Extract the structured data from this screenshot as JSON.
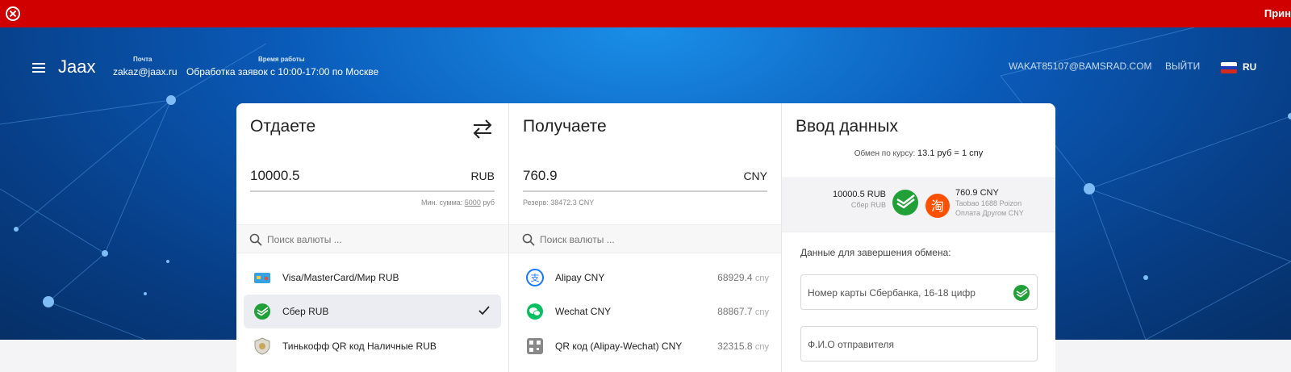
{
  "alert": {
    "text": "Прин"
  },
  "header": {
    "brand": "Jaax",
    "email_label": "Почта",
    "email_value": "zakaz@jaax.ru",
    "hours_label": "Время работы",
    "hours_value": "Обработка заявок с 10:00-17:00 по Москве",
    "user_email": "WAKAT85107@BAMSRAD.COM",
    "logout": "ВЫЙТИ",
    "lang": "RU"
  },
  "give": {
    "title": "Отдаете",
    "amount": "10000.5",
    "currency": "RUB",
    "min_prefix": "Мин. сумма: ",
    "min_value": "5000",
    "min_suffix": " руб",
    "search_placeholder": "Поиск валюты ...",
    "items": [
      {
        "label": "Visa/MasterCard/Мир RUB",
        "icon": "card-icon"
      },
      {
        "label": "Сбер RUB",
        "icon": "sber-icon",
        "selected": true
      },
      {
        "label": "Тинькофф QR код Наличные RUB",
        "icon": "tinkoff-icon"
      }
    ]
  },
  "get": {
    "title": "Получаете",
    "amount": "760.9",
    "currency": "CNY",
    "reserve": "Резерв: 38472.3 CNY",
    "search_placeholder": "Поиск валюты ...",
    "items": [
      {
        "label": "Alipay CNY",
        "value": "68929.4",
        "unit": "cny",
        "icon": "alipay-icon"
      },
      {
        "label": "Wechat CNY",
        "value": "88867.7",
        "unit": "cny",
        "icon": "wechat-icon"
      },
      {
        "label": "QR код (Alipay-Wechat) CNY",
        "value": "32315.8",
        "unit": "cny",
        "icon": "qr-icon"
      }
    ]
  },
  "details": {
    "title": "Ввод данных",
    "rate_label": "Обмен по курсу:",
    "rate_value": "13.1 руб = 1 cny",
    "give_amount": "10000.5 RUB",
    "give_name": "Сбер RUB",
    "get_amount": "760.9 CNY",
    "get_name1": "Taobao 1688 Poizon",
    "get_name2": "Оплата Другом CNY",
    "finish_label": "Данные для завершения обмена:",
    "card_placeholder": "Номер карты Сбербанка, 16-18 цифр",
    "name_placeholder": "Ф.И.О отправителя"
  },
  "colors": {
    "alert": "#d10000",
    "sber": "#21a038",
    "taobao": "#ff5000",
    "alipay": "#1677ff",
    "wechat": "#07c160"
  }
}
